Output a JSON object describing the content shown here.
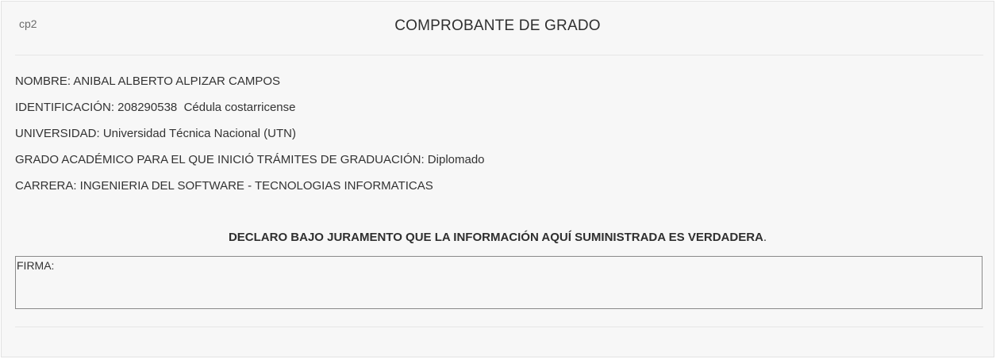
{
  "header": {
    "code": "cp2",
    "title": "COMPROBANTE DE GRADO"
  },
  "info": {
    "nombre": "NOMBRE: ANIBAL ALBERTO ALPIZAR CAMPOS",
    "identificacion": "IDENTIFICACIÓN: 208290538  Cédula costarricense",
    "universidad": "UNIVERSIDAD: Universidad Técnica Nacional (UTN)",
    "grado": "GRADO ACADÉMICO PARA EL QUE INICIÓ TRÁMITES DE GRADUACIÓN: Diplomado",
    "carrera": "CARRERA: INGENIERIA DEL SOFTWARE - TECNOLOGIAS INFORMATICAS"
  },
  "declaration": {
    "text": "DECLARO BAJO JURAMENTO QUE LA INFORMACIÓN AQUÍ SUMINISTRADA ES VERDADERA",
    "period": "."
  },
  "signature": {
    "label": "FIRMA:"
  }
}
